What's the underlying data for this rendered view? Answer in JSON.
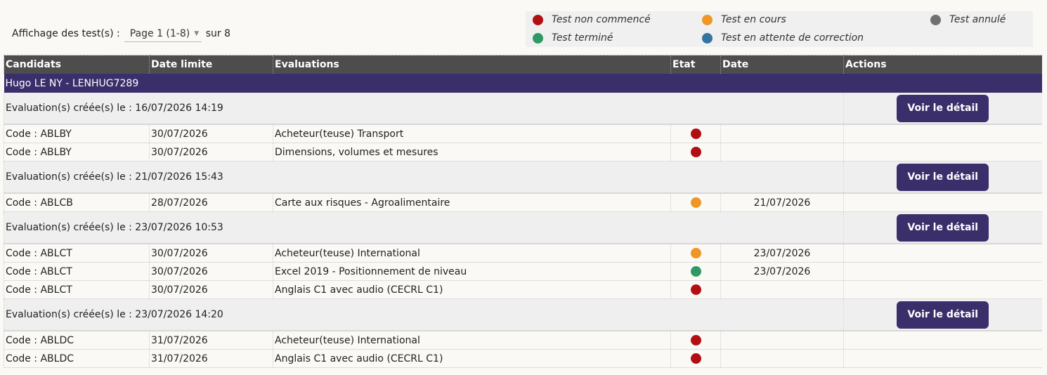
{
  "pager": {
    "label": "Affichage des test(s) :",
    "selected": "Page 1 (1-8)",
    "suffix": "sur 8"
  },
  "legend": [
    {
      "label": "Test non commencé",
      "color": "#b30f12"
    },
    {
      "label": "Test en cours",
      "color": "#ee9626"
    },
    {
      "label": "Test annulé",
      "color": "#707070"
    },
    {
      "label": "Test terminé",
      "color": "#2f9966"
    },
    {
      "label": "Test en attente de correction",
      "color": "#33759f"
    }
  ],
  "headers": [
    "Candidats",
    "Date limite",
    "Evaluations",
    "Etat",
    "Date",
    "Actions"
  ],
  "candidate": "Hugo LE NY - LENHUG7289",
  "button_label": "Voir le détail",
  "groups": [
    {
      "title": "Evaluation(s) créée(s) le : 16/07/2026 14:19",
      "rows": [
        {
          "code": "Code : ABLBY",
          "deadline": "30/07/2026",
          "evaluation": "Acheteur(teuse) Transport",
          "status_color": "#b30f12",
          "date": ""
        },
        {
          "code": "Code : ABLBY",
          "deadline": "30/07/2026",
          "evaluation": "Dimensions, volumes et mesures",
          "status_color": "#b30f12",
          "date": ""
        }
      ]
    },
    {
      "title": "Evaluation(s) créée(s) le : 21/07/2026 15:43",
      "rows": [
        {
          "code": "Code : ABLCB",
          "deadline": "28/07/2026",
          "evaluation": "Carte aux risques - Agroalimentaire",
          "status_color": "#ee9626",
          "date": "21/07/2026"
        }
      ]
    },
    {
      "title": "Evaluation(s) créée(s) le : 23/07/2026 10:53",
      "rows": [
        {
          "code": "Code : ABLCT",
          "deadline": "30/07/2026",
          "evaluation": "Acheteur(teuse) International",
          "status_color": "#ee9626",
          "date": "23/07/2026"
        },
        {
          "code": "Code : ABLCT",
          "deadline": "30/07/2026",
          "evaluation": "Excel 2019 - Positionnement de niveau",
          "status_color": "#2f9966",
          "date": "23/07/2026"
        },
        {
          "code": "Code : ABLCT",
          "deadline": "30/07/2026",
          "evaluation": "Anglais C1 avec audio (CECRL C1)",
          "status_color": "#b30f12",
          "date": ""
        }
      ]
    },
    {
      "title": "Evaluation(s) créée(s) le : 23/07/2026 14:20",
      "rows": [
        {
          "code": "Code : ABLDC",
          "deadline": "31/07/2026",
          "evaluation": "Acheteur(teuse) International",
          "status_color": "#b30f12",
          "date": ""
        },
        {
          "code": "Code : ABLDC",
          "deadline": "31/07/2026",
          "evaluation": "Anglais C1 avec audio (CECRL C1)",
          "status_color": "#b30f12",
          "date": ""
        }
      ]
    }
  ]
}
